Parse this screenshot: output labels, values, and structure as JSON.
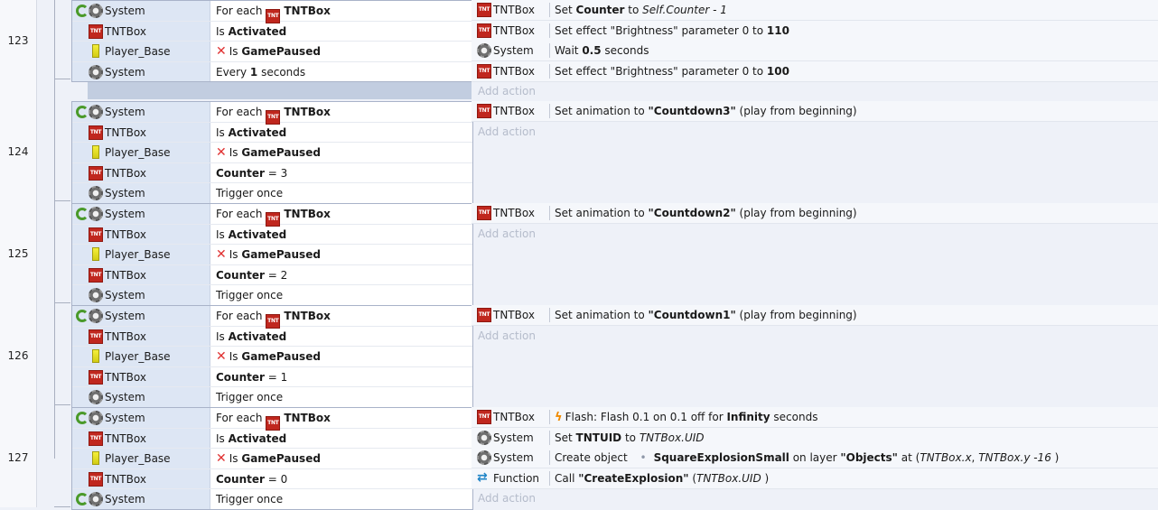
{
  "events": [
    {
      "number": "123",
      "conditions": [
        {
          "object": "System",
          "icon": "gear",
          "loop": true,
          "parts": [
            [
              "For each ",
              ""
            ],
            [
              "__tnt__",
              ""
            ],
            [
              "TNTBox",
              "b"
            ]
          ]
        },
        {
          "object": "TNTBox",
          "icon": "tnt",
          "parts": [
            [
              "Is ",
              ""
            ],
            [
              "Activated",
              "b"
            ]
          ]
        },
        {
          "object": "Player_Base",
          "icon": "player",
          "parts": [
            [
              "__x__",
              ""
            ],
            [
              "Is ",
              ""
            ],
            [
              "GamePaused",
              "b"
            ]
          ]
        },
        {
          "object": "System",
          "icon": "gear",
          "parts": [
            [
              "Every ",
              ""
            ],
            [
              "1",
              "b"
            ],
            [
              " seconds",
              ""
            ]
          ]
        }
      ],
      "actions": [
        {
          "object": "TNTBox",
          "icon": "tnt",
          "parts": [
            [
              "Set ",
              ""
            ],
            [
              "Counter",
              "b"
            ],
            [
              " to ",
              ""
            ],
            [
              "Self.Counter - 1",
              "i"
            ]
          ]
        },
        {
          "object": "TNTBox",
          "icon": "tnt",
          "parts": [
            [
              "Set effect \"Brightness\" parameter 0 to ",
              ""
            ],
            [
              "110",
              "b"
            ]
          ]
        },
        {
          "object": "System",
          "icon": "gear",
          "parts": [
            [
              "Wait ",
              ""
            ],
            [
              "0.5",
              "b"
            ],
            [
              " seconds",
              ""
            ]
          ]
        },
        {
          "object": "TNTBox",
          "icon": "tnt",
          "parts": [
            [
              "Set effect \"Brightness\" parameter 0 to ",
              ""
            ],
            [
              "100",
              "b"
            ]
          ]
        }
      ]
    },
    {
      "number": "124",
      "conditions": [
        {
          "object": "System",
          "icon": "gear",
          "loop": true,
          "parts": [
            [
              "For each ",
              ""
            ],
            [
              "__tnt__",
              ""
            ],
            [
              "TNTBox",
              "b"
            ]
          ]
        },
        {
          "object": "TNTBox",
          "icon": "tnt",
          "parts": [
            [
              "Is ",
              ""
            ],
            [
              "Activated",
              "b"
            ]
          ]
        },
        {
          "object": "Player_Base",
          "icon": "player",
          "parts": [
            [
              "__x__",
              ""
            ],
            [
              "Is ",
              ""
            ],
            [
              "GamePaused",
              "b"
            ]
          ]
        },
        {
          "object": "TNTBox",
          "icon": "tnt",
          "parts": [
            [
              "Counter",
              "b"
            ],
            [
              " = 3",
              ""
            ]
          ]
        },
        {
          "object": "System",
          "icon": "gear",
          "parts": [
            [
              "Trigger once",
              ""
            ]
          ]
        }
      ],
      "actions": [
        {
          "object": "TNTBox",
          "icon": "tnt",
          "parts": [
            [
              "Set animation to ",
              ""
            ],
            [
              "\"Countdown3\"",
              "b"
            ],
            [
              " (play from beginning)",
              ""
            ]
          ]
        }
      ]
    },
    {
      "number": "125",
      "conditions": [
        {
          "object": "System",
          "icon": "gear",
          "loop": true,
          "parts": [
            [
              "For each ",
              ""
            ],
            [
              "__tnt__",
              ""
            ],
            [
              "TNTBox",
              "b"
            ]
          ]
        },
        {
          "object": "TNTBox",
          "icon": "tnt",
          "parts": [
            [
              "Is ",
              ""
            ],
            [
              "Activated",
              "b"
            ]
          ]
        },
        {
          "object": "Player_Base",
          "icon": "player",
          "parts": [
            [
              "__x__",
              ""
            ],
            [
              "Is ",
              ""
            ],
            [
              "GamePaused",
              "b"
            ]
          ]
        },
        {
          "object": "TNTBox",
          "icon": "tnt",
          "parts": [
            [
              "Counter",
              "b"
            ],
            [
              " = 2",
              ""
            ]
          ]
        },
        {
          "object": "System",
          "icon": "gear",
          "parts": [
            [
              "Trigger once",
              ""
            ]
          ]
        }
      ],
      "actions": [
        {
          "object": "TNTBox",
          "icon": "tnt",
          "parts": [
            [
              "Set animation to ",
              ""
            ],
            [
              "\"Countdown2\"",
              "b"
            ],
            [
              " (play from beginning)",
              ""
            ]
          ]
        }
      ]
    },
    {
      "number": "126",
      "conditions": [
        {
          "object": "System",
          "icon": "gear",
          "loop": true,
          "parts": [
            [
              "For each ",
              ""
            ],
            [
              "__tnt__",
              ""
            ],
            [
              "TNTBox",
              "b"
            ]
          ]
        },
        {
          "object": "TNTBox",
          "icon": "tnt",
          "parts": [
            [
              "Is ",
              ""
            ],
            [
              "Activated",
              "b"
            ]
          ]
        },
        {
          "object": "Player_Base",
          "icon": "player",
          "parts": [
            [
              "__x__",
              ""
            ],
            [
              "Is ",
              ""
            ],
            [
              "GamePaused",
              "b"
            ]
          ]
        },
        {
          "object": "TNTBox",
          "icon": "tnt",
          "parts": [
            [
              "Counter",
              "b"
            ],
            [
              " = 1",
              ""
            ]
          ]
        },
        {
          "object": "System",
          "icon": "gear",
          "parts": [
            [
              "Trigger once",
              ""
            ]
          ]
        }
      ],
      "actions": [
        {
          "object": "TNTBox",
          "icon": "tnt",
          "parts": [
            [
              "Set animation to ",
              ""
            ],
            [
              "\"Countdown1\"",
              "b"
            ],
            [
              " (play from beginning)",
              ""
            ]
          ]
        }
      ]
    },
    {
      "number": "127",
      "conditions": [
        {
          "object": "System",
          "icon": "gear",
          "loop": true,
          "parts": [
            [
              "For each ",
              ""
            ],
            [
              "__tnt__",
              ""
            ],
            [
              "TNTBox",
              "b"
            ]
          ]
        },
        {
          "object": "TNTBox",
          "icon": "tnt",
          "parts": [
            [
              "Is ",
              ""
            ],
            [
              "Activated",
              "b"
            ]
          ]
        },
        {
          "object": "Player_Base",
          "icon": "player",
          "parts": [
            [
              "__x__",
              ""
            ],
            [
              "Is ",
              ""
            ],
            [
              "GamePaused",
              "b"
            ]
          ]
        },
        {
          "object": "TNTBox",
          "icon": "tnt",
          "parts": [
            [
              "Counter",
              "b"
            ],
            [
              " = 0",
              ""
            ]
          ]
        },
        {
          "object": "System",
          "icon": "gear",
          "loop": true,
          "parts": [
            [
              "Trigger once",
              ""
            ]
          ]
        }
      ],
      "actions": [
        {
          "object": "TNTBox",
          "icon": "tnt",
          "parts": [
            [
              "__flash__",
              ""
            ],
            [
              "Flash: Flash 0.1 on 0.1 off for ",
              ""
            ],
            [
              "Infinity",
              "b"
            ],
            [
              " seconds",
              ""
            ]
          ]
        },
        {
          "object": "System",
          "icon": "gear",
          "parts": [
            [
              "Set ",
              ""
            ],
            [
              "TNTUID",
              "b"
            ],
            [
              " to ",
              ""
            ],
            [
              "TNTBox.UID",
              "i"
            ]
          ]
        },
        {
          "object": "System",
          "icon": "gear",
          "parts": [
            [
              "Create object ",
              ""
            ],
            [
              "__dot__",
              ""
            ],
            [
              "SquareExplosionSmall",
              "b"
            ],
            [
              " on layer ",
              ""
            ],
            [
              "\"Objects\"",
              "b"
            ],
            [
              " at (",
              ""
            ],
            [
              "TNTBox.x",
              "i"
            ],
            [
              ", ",
              ""
            ],
            [
              "TNTBox.y -16",
              "i"
            ],
            [
              " )",
              ""
            ]
          ]
        },
        {
          "object": "Function",
          "icon": "function",
          "parts": [
            [
              "Call ",
              ""
            ],
            [
              "\"CreateExplosion\"",
              "b"
            ],
            [
              " (",
              ""
            ],
            [
              "TNTBox.UID",
              "i"
            ],
            [
              " )",
              ""
            ]
          ]
        }
      ]
    }
  ],
  "ui": {
    "add_action_label": "Add action",
    "tnt_icon_text": "TNT",
    "dot_glyph": "•"
  },
  "colors": {
    "condition_object_bg": "#dde6f4",
    "selected_row_bg": "#c2cde0",
    "action_row_bg": "#f5f7fb",
    "disabled_text": "#b5bccb"
  }
}
